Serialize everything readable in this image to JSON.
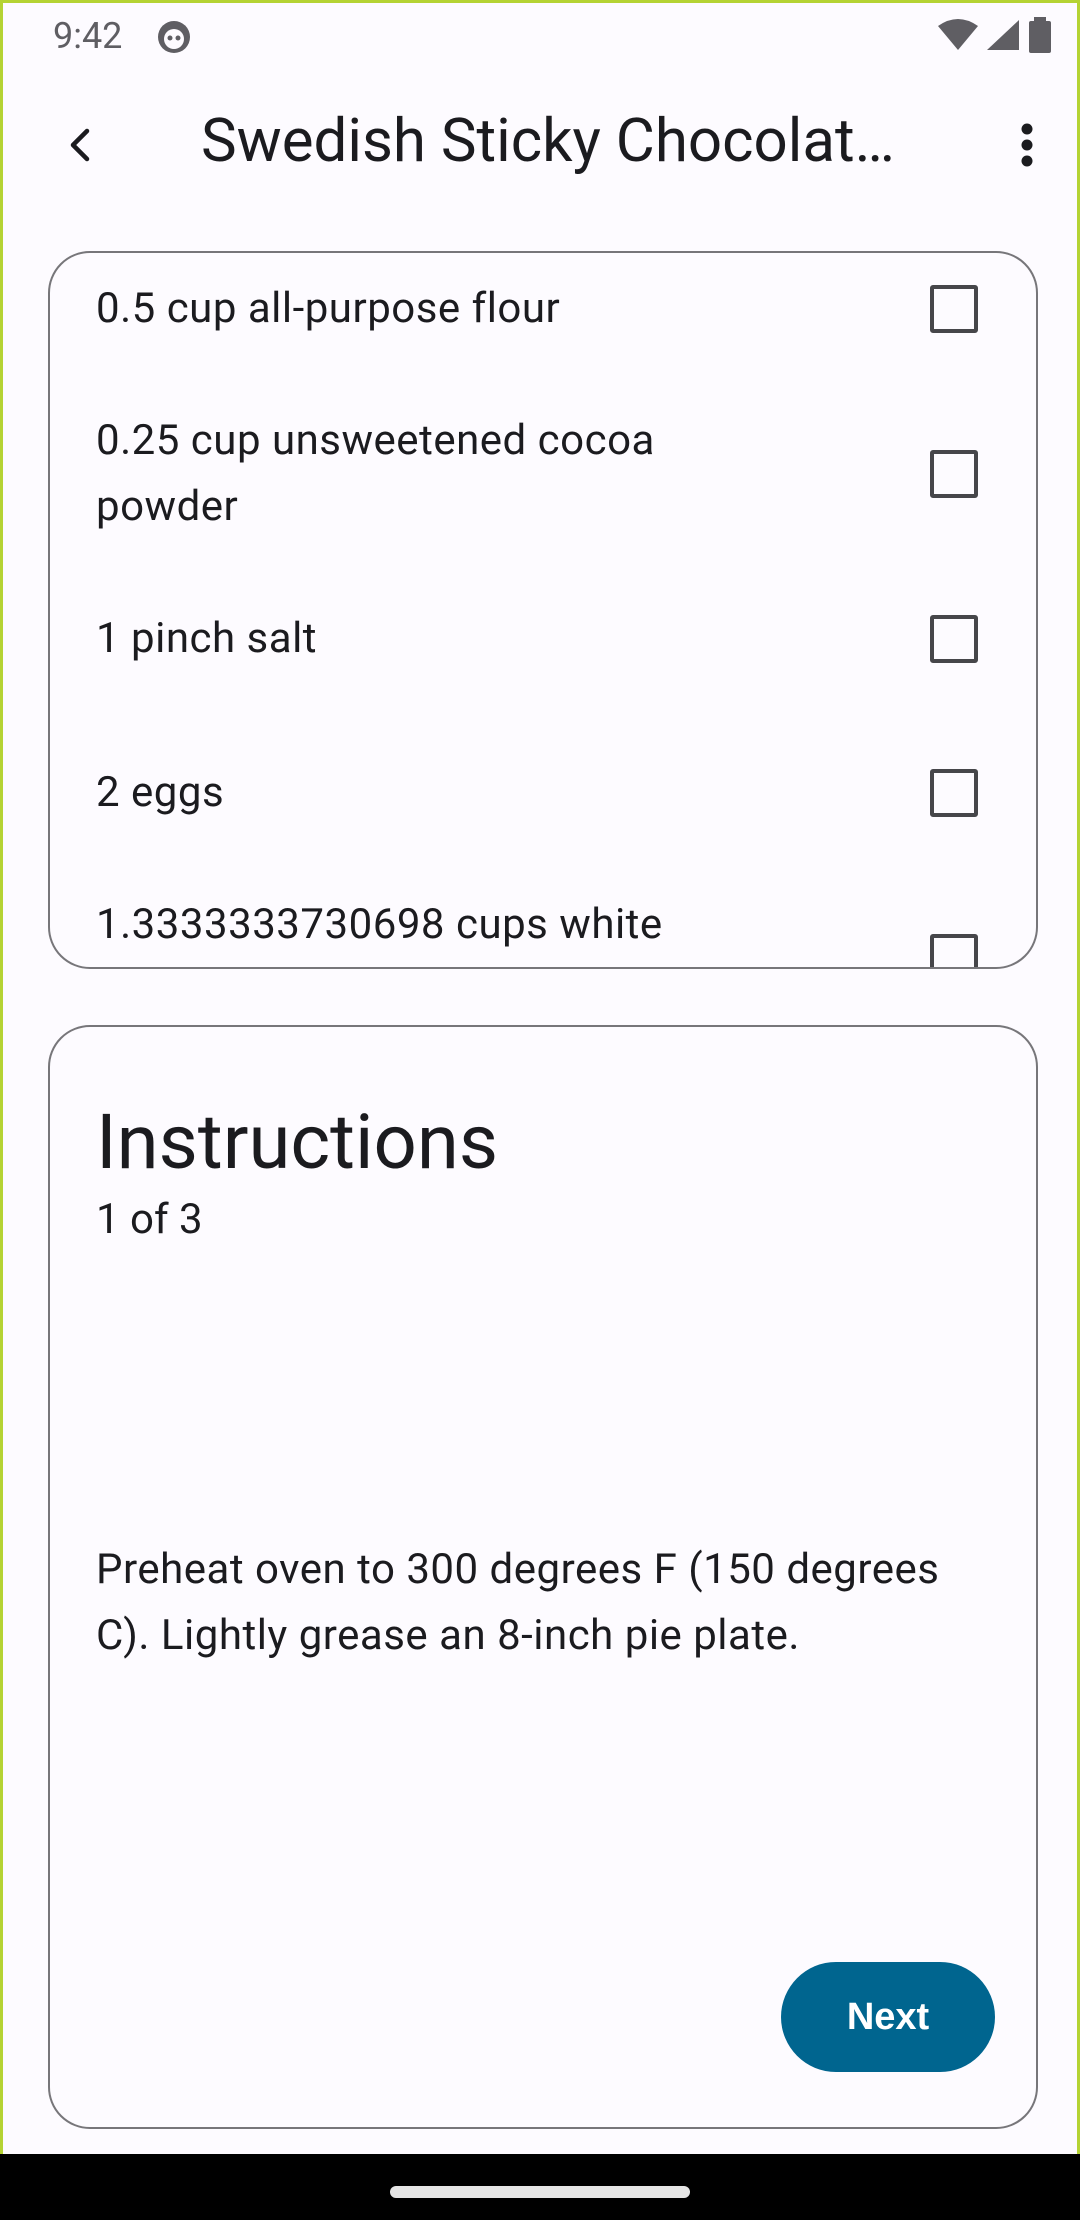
{
  "status_bar": {
    "time": "9:42",
    "icons": [
      "app-notification-icon",
      "wifi-icon",
      "cell-signal-icon",
      "battery-icon"
    ]
  },
  "app_bar": {
    "title": "Swedish Sticky Chocolat…",
    "back_icon": "arrow-back-icon",
    "more_icon": "more-vert-icon"
  },
  "ingredients": [
    {
      "text": "0.5 cup all-purpose flour",
      "checked": false
    },
    {
      "text": "0.25 cup unsweetened cocoa powder",
      "checked": false
    },
    {
      "text": "1 pinch salt",
      "checked": false
    },
    {
      "text": "2 eggs",
      "checked": false
    },
    {
      "text": "1.3333333730698 cups white",
      "checked": false
    }
  ],
  "instructions": {
    "heading": "Instructions",
    "step_label": "1 of 3",
    "step_text": "Preheat oven to 300 degrees F (150 degrees C). Lightly grease an 8-inch pie plate.",
    "next_label": "Next"
  },
  "colors": {
    "primary": "#00658f",
    "outline": "#77767a",
    "background": "#fdfbff"
  }
}
